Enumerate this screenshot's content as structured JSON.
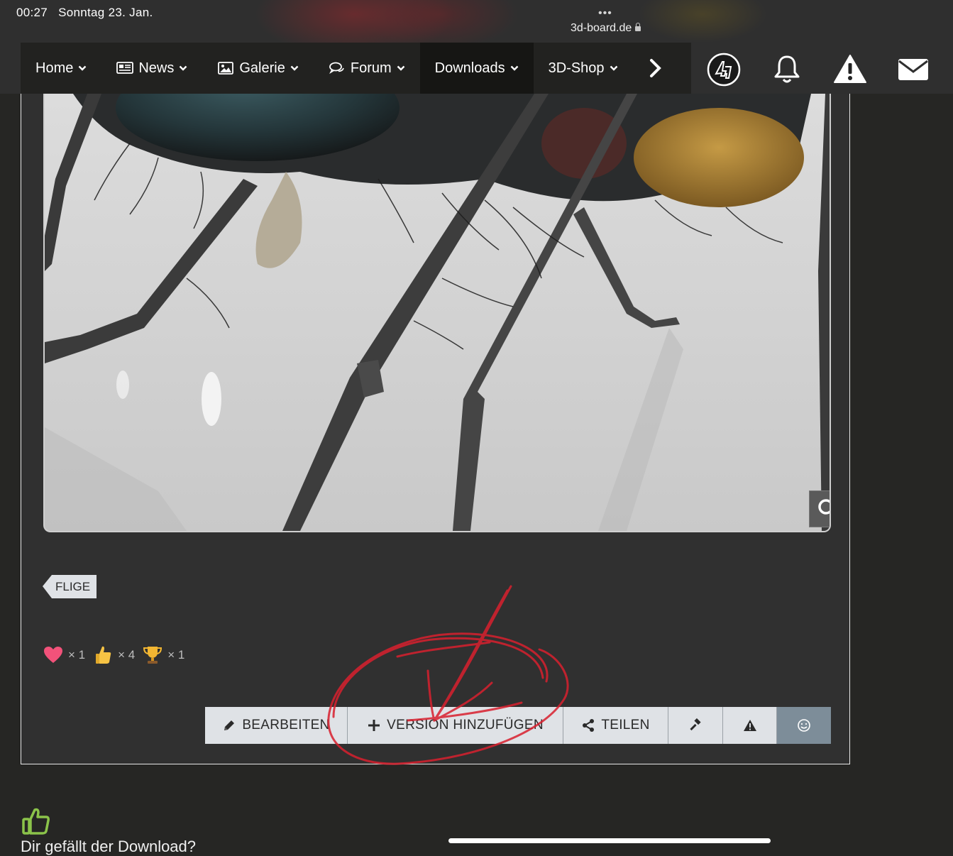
{
  "status_bar": {
    "time": "00:27",
    "date": "Sonntag 23. Jan.",
    "dots": "•••",
    "url": "3d-board.de"
  },
  "nav": {
    "items": [
      {
        "label": "Home",
        "icon": "none",
        "has_dropdown": true
      },
      {
        "label": "News",
        "icon": "newspaper-icon",
        "has_dropdown": true
      },
      {
        "label": "Galerie",
        "icon": "image-icon",
        "has_dropdown": true
      },
      {
        "label": "Forum",
        "icon": "chat-bubbles-icon",
        "has_dropdown": true
      },
      {
        "label": "Downloads",
        "icon": "none",
        "has_dropdown": true,
        "active": true
      },
      {
        "label": "3D-Shop",
        "icon": "none",
        "has_dropdown": true
      }
    ],
    "right_icons": [
      "user-avatar-icon",
      "bell-icon",
      "warning-icon",
      "envelope-icon"
    ]
  },
  "content": {
    "image_alt_subject": "fly",
    "tag": "FLIGE",
    "reactions": [
      {
        "icon": "heart-icon",
        "count": "× 1"
      },
      {
        "icon": "thumbs-up-icon",
        "count": "× 4"
      },
      {
        "icon": "trophy-icon",
        "count": "× 1"
      }
    ],
    "actions": {
      "edit": "BEARBEITEN",
      "add_version": "VERSION HINZUFÜGEN",
      "share": "TEILEN"
    }
  },
  "footer": {
    "question": "Dir gefällt der Download?"
  },
  "colors": {
    "page_bg": "#262624",
    "nav_bg": "#222220",
    "nav_active": "#161614",
    "card_bg": "#303030",
    "button_bg": "#dfe2e6",
    "react_button": "#7d8d99",
    "like_green": "#8bc34a",
    "annotation_red": "#d9202e"
  }
}
